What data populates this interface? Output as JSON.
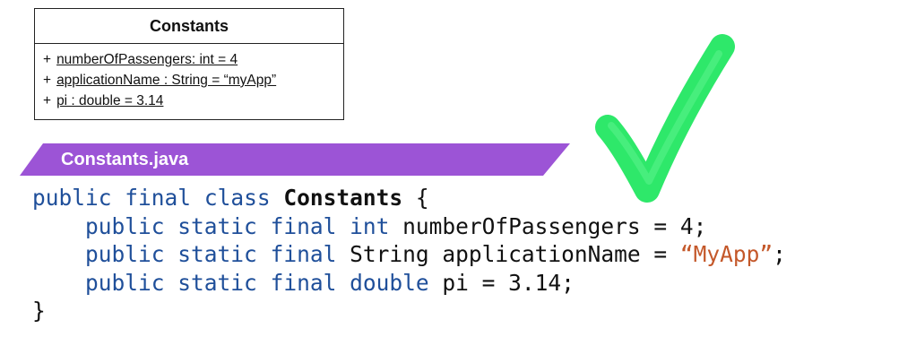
{
  "colors": {
    "banner": "#9c54d6",
    "keyword": "#1f4f9a",
    "string": "#c4582a",
    "check": "#2ee86a",
    "text": "#111111"
  },
  "uml": {
    "class_name": "Constants",
    "attributes": [
      {
        "visibility": "+",
        "text": "numberOfPassengers: int = 4"
      },
      {
        "visibility": "+",
        "text": "applicationName : String = “myApp”"
      },
      {
        "visibility": "+",
        "text": "pi : double = 3.14"
      }
    ]
  },
  "banner": {
    "label": "Constants.java"
  },
  "code": {
    "line1": {
      "k1": "public",
      "k2": "final",
      "k3": "class",
      "name": "Constants",
      "brace": "{"
    },
    "line2": {
      "k1": "public",
      "k2": "static",
      "k3": "final",
      "type": "int",
      "rest": "numberOfPassengers = 4;"
    },
    "line3": {
      "k1": "public",
      "k2": "static",
      "k3": "final",
      "type": "String",
      "mid": "applicationName = ",
      "str": "“MyApp”",
      "end": ";"
    },
    "line4": {
      "k1": "public",
      "k2": "static",
      "k3": "final",
      "type": "double",
      "rest": "pi = 3.14;"
    },
    "line5": {
      "brace": "}"
    }
  },
  "check_icon": "checkmark-icon"
}
